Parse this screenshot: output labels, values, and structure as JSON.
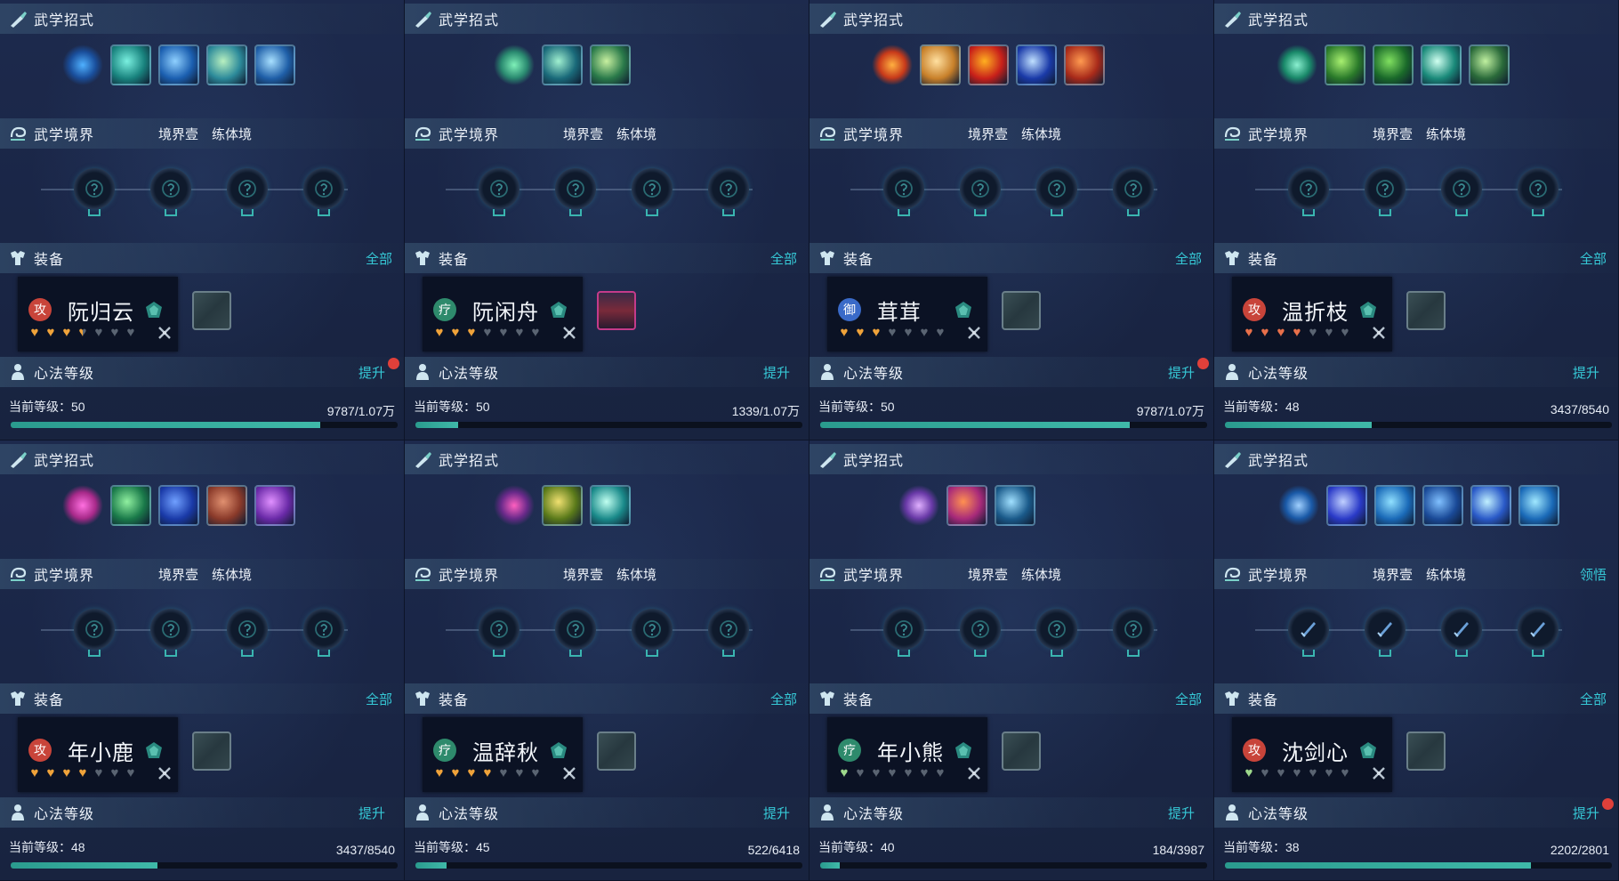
{
  "labels": {
    "skills_title": "武学招式",
    "realm_title": "武学境界",
    "realm_level": "境界壹",
    "realm_stage": "练体境",
    "equip_title": "装备",
    "equip_all": "全部",
    "heart_title": "心法等级",
    "heart_upgrade": "提升",
    "current_level_prefix": "当前等级："
  },
  "colors": {
    "accent": "#36c8d6",
    "progress": "#3fb9a9",
    "heart_gold": "#f0a33a",
    "heart_red": "#e8704a",
    "heart_green": "#9ed98c",
    "heart_empty": "#5a6472",
    "notice_dot": "#e0403a"
  },
  "panels": [
    {
      "character": "阮归云",
      "badge": "攻",
      "badge_color": "#c8443a",
      "hearts": [
        "gold",
        "gold",
        "gold",
        "half",
        "empty",
        "empty",
        "empty"
      ],
      "slot": "empty",
      "level": "50",
      "exp": "9787/1.07万",
      "progress": 0.8,
      "notice": true,
      "realm_action": "",
      "skill_colors": [
        [
          "#1a4f9c",
          "#4fb0ff"
        ],
        [
          "#19837e",
          "#7af0e0"
        ],
        [
          "#1b5fb0",
          "#8fd0ff"
        ],
        [
          "#2c8a9a",
          "#b8f0c0"
        ],
        [
          "#1f5fa8",
          "#a8e0ff"
        ]
      ],
      "node_style": "locked"
    },
    {
      "character": "阮闲舟",
      "badge": "疗",
      "badge_color": "#2e8a6c",
      "hearts": [
        "gold",
        "gold",
        "gold",
        "empty",
        "empty",
        "empty",
        "empty"
      ],
      "slot": "portrait",
      "level": "50",
      "exp": "1339/1.07万",
      "progress": 0.11,
      "notice": false,
      "realm_action": "",
      "skill_colors": [
        [
          "#2a8a70",
          "#7ef0b8"
        ],
        [
          "#1a6a7a",
          "#a0f0d0"
        ],
        [
          "#2a7a4a",
          "#c8f0a0"
        ]
      ],
      "node_style": "locked"
    },
    {
      "character": "茸茸",
      "badge": "御",
      "badge_color": "#3a6ac8",
      "hearts": [
        "gold",
        "gold",
        "gold",
        "empty",
        "empty",
        "empty",
        "empty"
      ],
      "slot": "empty",
      "level": "50",
      "exp": "9787/1.07万",
      "progress": 0.8,
      "notice": true,
      "realm_action": "",
      "skill_colors": [
        [
          "#c83a1a",
          "#ffb040"
        ],
        [
          "#c8802a",
          "#ffe0a0"
        ],
        [
          "#c8201a",
          "#ffb020"
        ],
        [
          "#1a3aa8",
          "#c0e0ff"
        ],
        [
          "#a82a1a",
          "#ff9a50"
        ]
      ],
      "node_style": "locked"
    },
    {
      "character": "温折枝",
      "badge": "攻",
      "badge_color": "#c8443a",
      "hearts": [
        "red",
        "red",
        "red",
        "red",
        "empty",
        "empty",
        "empty"
      ],
      "slot": "empty",
      "level": "48",
      "exp": "3437/8540",
      "progress": 0.38,
      "notice": false,
      "realm_action": "",
      "skill_colors": [
        [
          "#1a8a6a",
          "#8af0d0"
        ],
        [
          "#2a7a2a",
          "#a8f070"
        ],
        [
          "#1a6a2a",
          "#80e060"
        ],
        [
          "#1a8a7a",
          "#d0fff0"
        ],
        [
          "#2a6a3a",
          "#c0f0a0"
        ]
      ],
      "node_style": "locked"
    },
    {
      "character": "年小鹿",
      "badge": "攻",
      "badge_color": "#c8443a",
      "hearts": [
        "gold",
        "gold",
        "gold",
        "gold",
        "empty",
        "empty",
        "empty"
      ],
      "slot": "empty",
      "level": "48",
      "exp": "3437/8540",
      "progress": 0.38,
      "notice": false,
      "realm_action": "",
      "skill_colors": [
        [
          "#a82a8a",
          "#ff70e0"
        ],
        [
          "#1a7a4a",
          "#90f0a0"
        ],
        [
          "#1a3aa8",
          "#70a0ff"
        ],
        [
          "#8a3a2a",
          "#e09070"
        ],
        [
          "#6a2aa8",
          "#e090ff"
        ]
      ],
      "node_style": "locked"
    },
    {
      "character": "温辞秋",
      "badge": "疗",
      "badge_color": "#2e8a6c",
      "hearts": [
        "gold",
        "gold",
        "gold",
        "gold",
        "empty",
        "empty",
        "empty"
      ],
      "slot": "empty",
      "level": "45",
      "exp": "522/6418",
      "progress": 0.08,
      "notice": false,
      "realm_action": "",
      "skill_colors": [
        [
          "#6a2a8a",
          "#ff60c0"
        ],
        [
          "#5a7a1a",
          "#f0e070"
        ],
        [
          "#1a8a8a",
          "#c0fff0"
        ]
      ],
      "node_style": "locked"
    },
    {
      "character": "年小熊",
      "badge": "疗",
      "badge_color": "#2e8a6c",
      "hearts": [
        "green",
        "empty",
        "empty",
        "empty",
        "empty",
        "empty",
        "empty"
      ],
      "slot": "empty",
      "level": "40",
      "exp": "184/3987",
      "progress": 0.05,
      "notice": false,
      "realm_action": "",
      "skill_colors": [
        [
          "#6a3aa8",
          "#e0b0ff"
        ],
        [
          "#a82a7a",
          "#ff9050"
        ],
        [
          "#1a5a8a",
          "#a0e0ff"
        ]
      ],
      "node_style": "locked"
    },
    {
      "character": "沈剑心",
      "badge": "攻",
      "badge_color": "#c8443a",
      "hearts": [
        "green",
        "empty",
        "empty",
        "empty",
        "empty",
        "empty",
        "empty"
      ],
      "slot": "empty",
      "level": "38",
      "exp": "2202/2801",
      "progress": 0.79,
      "notice": true,
      "realm_action": "领悟",
      "skill_colors": [
        [
          "#1a5aa8",
          "#a0d0ff"
        ],
        [
          "#2a3ac8",
          "#c0d0ff"
        ],
        [
          "#1a6ab8",
          "#90e0ff"
        ],
        [
          "#1a4a98",
          "#80c0ff"
        ],
        [
          "#2a5ac8",
          "#c0f0ff"
        ],
        [
          "#1a6ab8",
          "#a0e8ff"
        ]
      ],
      "node_style": "sword"
    }
  ]
}
